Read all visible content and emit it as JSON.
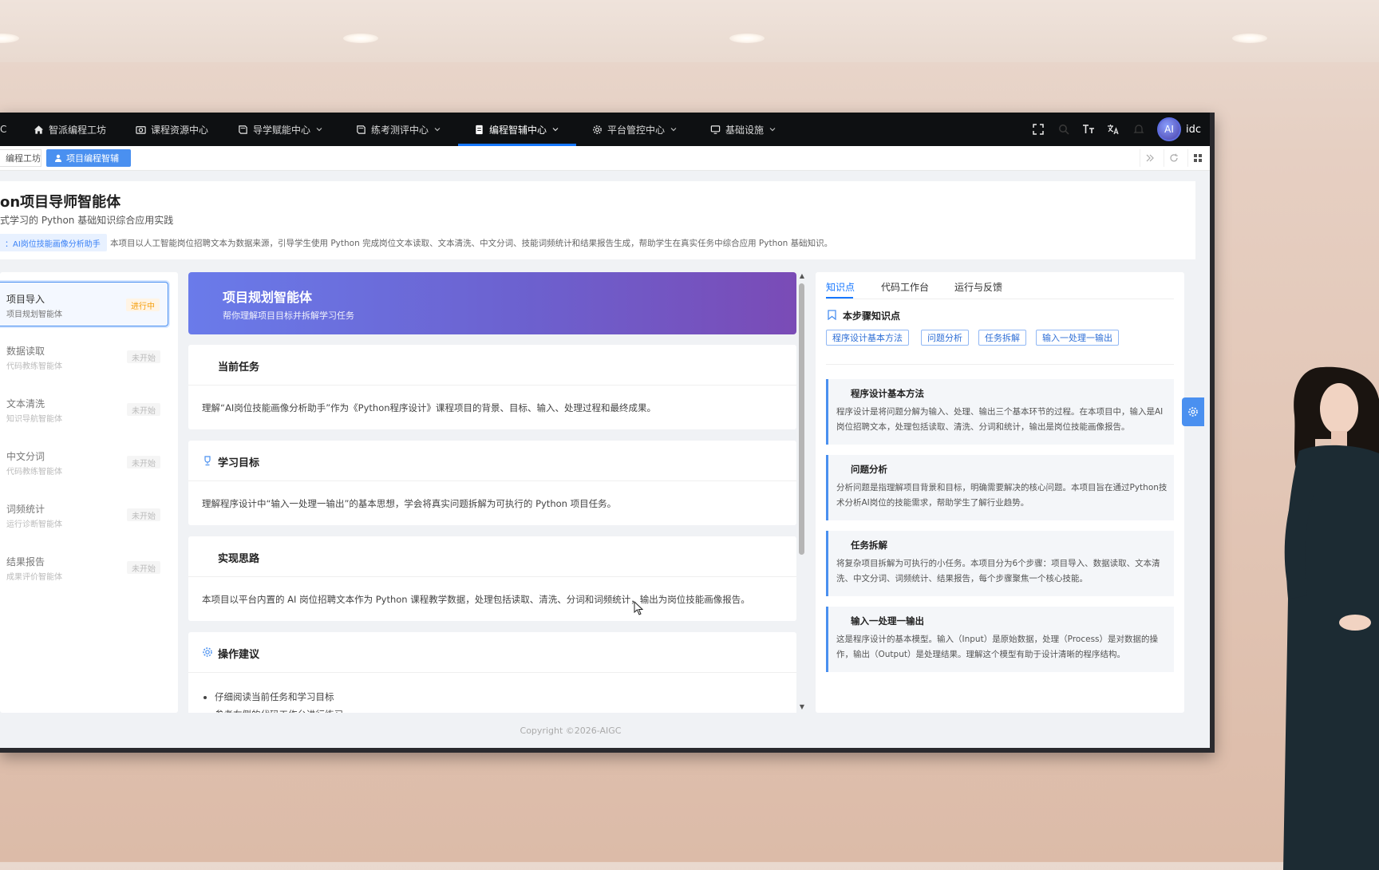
{
  "nav": {
    "brand_fragment": "C",
    "items": [
      {
        "label": "智派编程工坊",
        "icon": "home-icon"
      },
      {
        "label": "课程资源中心",
        "icon": "camera-icon"
      },
      {
        "label": "导学赋能中心",
        "icon": "book-icon"
      },
      {
        "label": "练考测评中心",
        "icon": "book-icon"
      },
      {
        "label": "编程智辅中心",
        "icon": "document-icon",
        "active": true
      },
      {
        "label": "平台管控中心",
        "icon": "gear-icon"
      },
      {
        "label": "基础设施",
        "icon": "monitor-icon"
      }
    ],
    "avatar_text": "AI",
    "user_name": "idc"
  },
  "tabs": {
    "plain_label": "编程工坊",
    "active_label": "项目编程智辅"
  },
  "header": {
    "title": "on项目导师智能体",
    "subtitle": "式学习的 Python 基础知识综合应用实践",
    "project_tag": "：AI岗位技能画像分析助手",
    "project_desc": "本项目以人工智能岗位招聘文本为数据来源，引导学生使用 Python 完成岗位文本读取、文本清洗、中文分词、技能词频统计和结果报告生成，帮助学生在真实任务中综合应用 Python 基础知识。"
  },
  "steps": [
    {
      "title": "项目导入",
      "agent": "项目规划智能体",
      "status": "进行中"
    },
    {
      "title": "数据读取",
      "agent": "代码教练智能体",
      "status": "未开始"
    },
    {
      "title": "文本清洗",
      "agent": "知识导航智能体",
      "status": "未开始"
    },
    {
      "title": "中文分词",
      "agent": "代码教练智能体",
      "status": "未开始"
    },
    {
      "title": "词频统计",
      "agent": "运行诊断智能体",
      "status": "未开始"
    },
    {
      "title": "结果报告",
      "agent": "成果评价智能体",
      "status": "未开始"
    }
  ],
  "agent": {
    "title": "项目规划智能体",
    "subtitle": "帮你理解项目目标并拆解学习任务"
  },
  "cards": {
    "task": {
      "title": "当前任务",
      "body": "理解“AI岗位技能画像分析助手”作为《Python程序设计》课程项目的背景、目标、输入、处理过程和最终成果。"
    },
    "goal": {
      "title": "学习目标",
      "body": "理解程序设计中“输入一处理一输出”的基本思想，学会将真实问题拆解为可执行的 Python 项目任务。"
    },
    "approach": {
      "title": "实现思路",
      "body": "本项目以平台内置的 AI 岗位招聘文本作为 Python 课程教学数据，处理包括读取、清洗、分词和词频统计，输出为岗位技能画像报告。"
    },
    "tips": {
      "title": "操作建议",
      "items": [
        "仔细阅读当前任务和学习目标",
        "参考右侧的代码工作台进行练习"
      ]
    }
  },
  "right": {
    "tabs": [
      "知识点",
      "代码工作台",
      "运行与反馈"
    ],
    "heading": "本步骤知识点",
    "tags": [
      "程序设计基本方法",
      "问题分析",
      "任务拆解",
      "输入一处理一输出"
    ],
    "cards": [
      {
        "title": "程序设计基本方法",
        "text": "程序设计是将问题分解为输入、处理、输出三个基本环节的过程。在本项目中，输入是AI岗位招聘文本，处理包括读取、清洗、分词和统计，输出是岗位技能画像报告。"
      },
      {
        "title": "问题分析",
        "text": "分析问题是指理解项目背景和目标，明确需要解决的核心问题。本项目旨在通过Python技术分析AI岗位的技能需求，帮助学生了解行业趋势。"
      },
      {
        "title": "任务拆解",
        "text": "将复杂项目拆解为可执行的小任务。本项目分为6个步骤：项目导入、数据读取、文本清洗、中文分词、词频统计、结果报告，每个步骤聚焦一个核心技能。"
      },
      {
        "title": "输入一处理一输出",
        "text": "这是程序设计的基本模型。输入（Input）是原始数据，处理（Process）是对数据的操作，输出（Output）是处理结果。理解这个模型有助于设计清晰的程序结构。"
      }
    ]
  },
  "footer": "Copyright ©2026-AIGC"
}
